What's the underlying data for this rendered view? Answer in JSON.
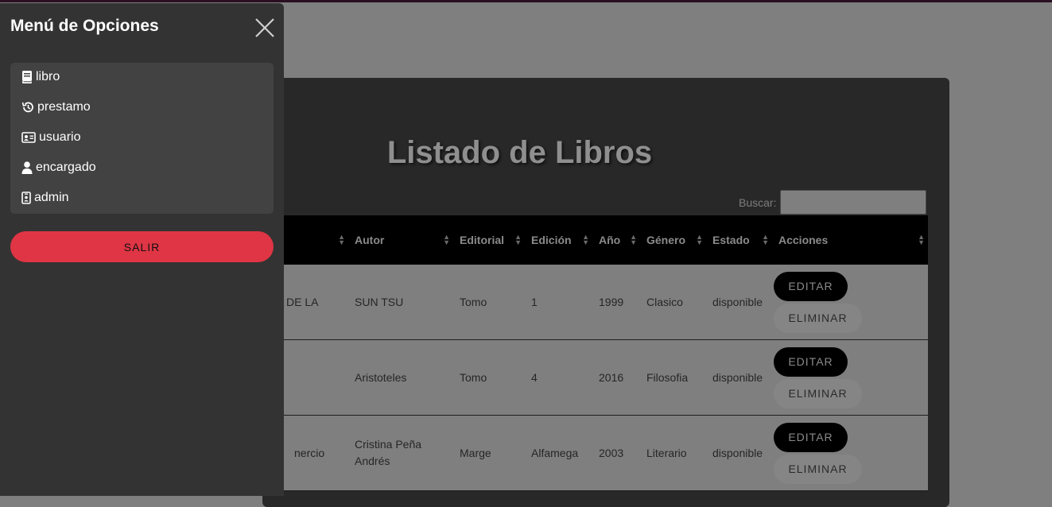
{
  "sidebar": {
    "title": "Menú de Opciones",
    "close_icon": "close-icon",
    "items": [
      {
        "label": "libro",
        "icon": "book-icon"
      },
      {
        "label": "prestamo",
        "icon": "history-icon"
      },
      {
        "label": "usuario",
        "icon": "id-card-icon"
      },
      {
        "label": "encargado",
        "icon": "user-icon"
      },
      {
        "label": "admin",
        "icon": "id-badge-icon"
      }
    ],
    "logout_label": "SALIR"
  },
  "main": {
    "title": "Listado de Libros",
    "search_label": "Buscar:",
    "search_value": "",
    "columns": [
      "",
      "Autor",
      "Editorial",
      "Edición",
      "Año",
      "Género",
      "Estado",
      "Acciones"
    ],
    "rows": [
      {
        "titulo": "DE LA",
        "autor": "SUN TSU",
        "editorial": "Tomo",
        "edicion": "1",
        "anio": "1999",
        "genero": "Clasico",
        "estado": "disponible"
      },
      {
        "titulo": "",
        "autor": "Aristoteles",
        "editorial": "Tomo",
        "edicion": "4",
        "anio": "2016",
        "genero": "Filosofia",
        "estado": "disponible"
      },
      {
        "titulo": "nercio",
        "autor": "Cristina Peña Andrés",
        "editorial": "Marge",
        "edicion": "Alfamega",
        "anio": "2003",
        "genero": "Literario",
        "estado": "disponible"
      }
    ],
    "edit_label": "EDITAR",
    "delete_label": "ELIMINAR"
  },
  "colors": {
    "overlay": "#7f7f7f",
    "sidebar_bg": "#333333",
    "logout_red": "#df3545",
    "table_header": "#000000"
  }
}
